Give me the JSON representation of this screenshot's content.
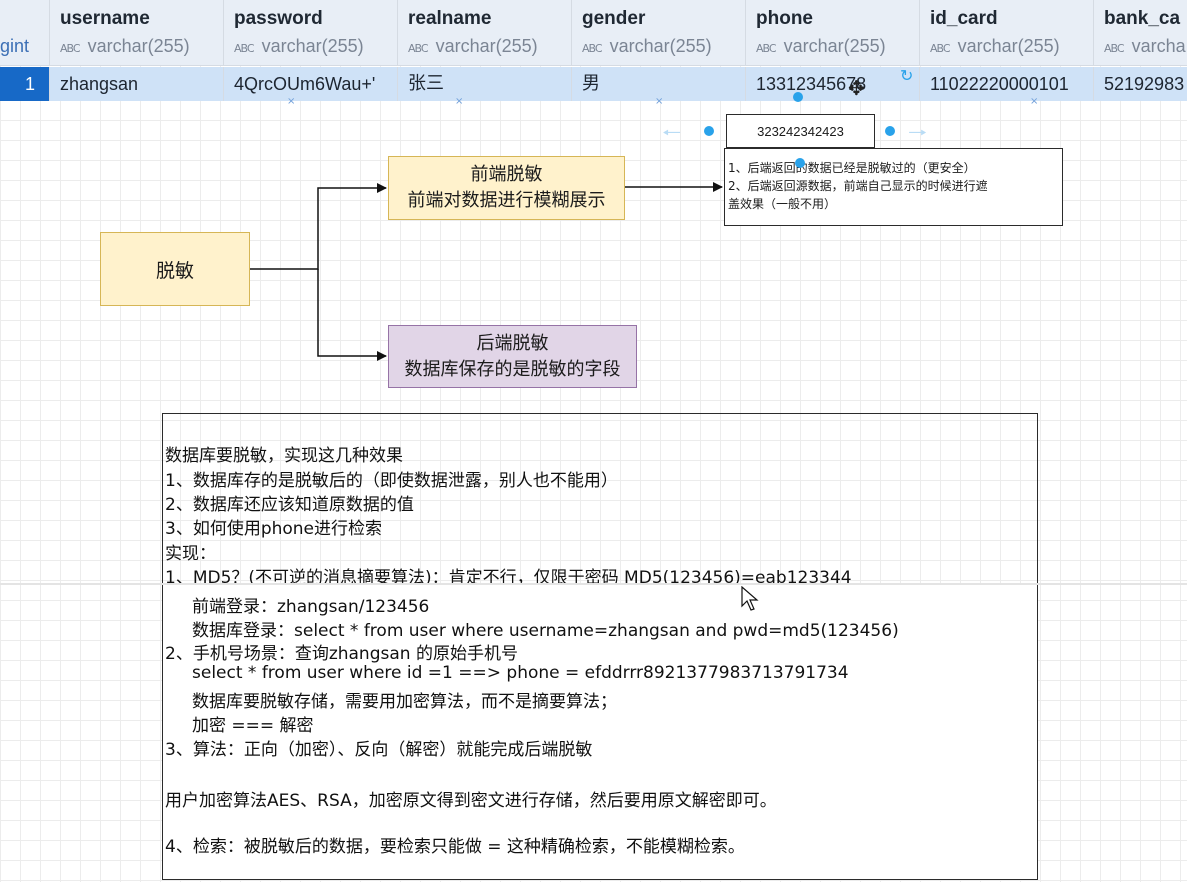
{
  "table": {
    "partial_first_col": "gint",
    "columns": [
      {
        "name": "username",
        "type": "varchar(255)"
      },
      {
        "name": "password",
        "type": "varchar(255)"
      },
      {
        "name": "realname",
        "type": "varchar(255)"
      },
      {
        "name": "gender",
        "type": "varchar(255)"
      },
      {
        "name": "phone",
        "type": "varchar(255)"
      },
      {
        "name": "id_card",
        "type": "varchar(255)"
      },
      {
        "name": "bank_ca",
        "type": "varcha"
      }
    ],
    "type_icon": "ABC",
    "row": {
      "num": "1",
      "cells": [
        "zhangsan",
        "4QrcOUm6Wau+'",
        "张三",
        "男",
        "13312345678",
        "11022220000101",
        "52192983"
      ]
    }
  },
  "diagram": {
    "root": "脱敏",
    "front": {
      "line1": "前端脱敏",
      "line2": "前端对数据进行模糊展示"
    },
    "back": {
      "line1": "后端脱敏",
      "line2": "数据库保存的是脱敏的字段"
    },
    "selected_value": "323242342423",
    "note": [
      "1、后端返回的数据已经是脱敏过的（更安全）",
      "2、后端返回源数据，前端自己显示的时候进行遮",
      "盖效果（一般不用）"
    ],
    "colors": {
      "yellow_fill": "#fff2cc",
      "yellow_border": "#d6b656",
      "purple_fill": "#e1d5e7",
      "purple_border": "#9673a6",
      "handle": "#29a2ea"
    }
  },
  "textbox": {
    "lines": [
      "数据库要脱敏，实现这几种效果",
      "1、数据库存的是脱敏后的（即使数据泄露，别人也不能用）",
      "2、数据库还应该知道原数据的值",
      "3、如何使用phone进行检索",
      "实现：",
      "1、MD5？(不可逆的消息摘要算法)：肯定不行，仅限于密码  MD5(123456)=eab123344",
      "前端登录：zhangsan/123456",
      "数据库登录：select * from user where username=zhangsan and pwd=md5(123456)",
      "2、手机号场景：查询zhangsan 的原始手机号",
      "select * from user where id =1 ==> phone = efddrrr8921377983713791734",
      "数据库要脱敏存储，需要用加密算法，而不是摘要算法；",
      "加密 === 解密",
      "3、算法：正向（加密）、反向（解密）就能完成后端脱敏",
      "用户加密算法AES、RSA，加密原文得到密文进行存储，然后要用原文解密即可。",
      "4、检索：被脱敏后的数据，要检索只能做 = 这种精确检索，不能模糊检索。"
    ]
  }
}
